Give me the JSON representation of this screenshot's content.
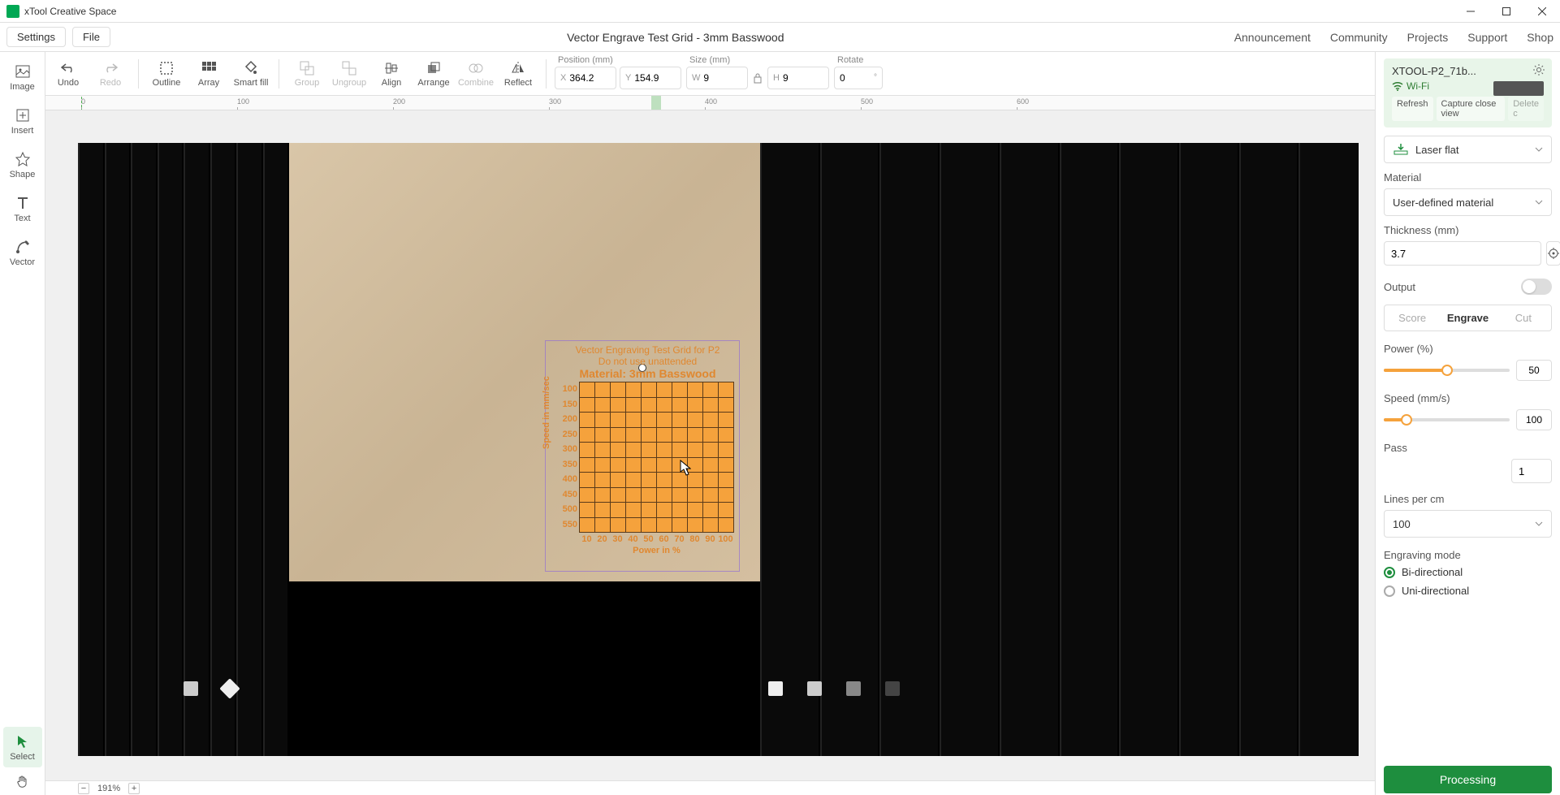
{
  "app": {
    "title": "xTool Creative Space"
  },
  "menubar": {
    "settings": "Settings",
    "file": "File",
    "doc_title": "Vector Engrave Test Grid - 3mm Basswood",
    "links": {
      "announcement": "Announcement",
      "community": "Community",
      "projects": "Projects",
      "support": "Support",
      "shop": "Shop"
    }
  },
  "toolbar": {
    "undo": "Undo",
    "redo": "Redo",
    "outline": "Outline",
    "array": "Array",
    "smartfill": "Smart fill",
    "group": "Group",
    "ungroup": "Ungroup",
    "align": "Align",
    "arrange": "Arrange",
    "combine": "Combine",
    "reflect": "Reflect",
    "position_label": "Position (mm)",
    "size_label": "Size (mm)",
    "rotate_label": "Rotate",
    "x": "364.2",
    "y": "154.9",
    "w": "9",
    "h": "9",
    "rotate": "0"
  },
  "left_tools": {
    "image": "Image",
    "insert": "Insert",
    "shape": "Shape",
    "text": "Text",
    "vector": "Vector",
    "select": "Select"
  },
  "ruler": {
    "ticks": [
      "0",
      "100",
      "200",
      "300",
      "400",
      "500",
      "600"
    ]
  },
  "canvas": {
    "grid": {
      "title1": "Vector Engraving Test Grid for P2",
      "title2": "Do not use unattended",
      "title3": "Material: 3mm Basswood",
      "y_labels": [
        "100",
        "150",
        "200",
        "250",
        "300",
        "350",
        "400",
        "450",
        "500",
        "550"
      ],
      "x_labels": [
        "10",
        "20",
        "30",
        "40",
        "50",
        "60",
        "70",
        "80",
        "90",
        "100"
      ],
      "y_axis": "Speed in mm/sec",
      "x_axis": "Power in %"
    }
  },
  "right": {
    "device": {
      "name": "XTOOL-P2_71b...",
      "conn": "Wi-Fi",
      "refresh": "Refresh",
      "capture": "Capture close view",
      "delete": "Delete c"
    },
    "mode": "Laser flat",
    "material_label": "Material",
    "material": "User-defined material",
    "thickness_label": "Thickness (mm)",
    "thickness": "3.7",
    "output_label": "Output",
    "tabs": {
      "score": "Score",
      "engrave": "Engrave",
      "cut": "Cut"
    },
    "power_label": "Power (%)",
    "power": "50",
    "speed_label": "Speed (mm/s)",
    "speed": "100",
    "pass_label": "Pass",
    "pass": "1",
    "lines_label": "Lines per cm",
    "lines": "100",
    "engmode_label": "Engraving mode",
    "bidir": "Bi-directional",
    "unidir": "Uni-directional",
    "processing": "Processing"
  },
  "status": {
    "zoom": "191%"
  }
}
